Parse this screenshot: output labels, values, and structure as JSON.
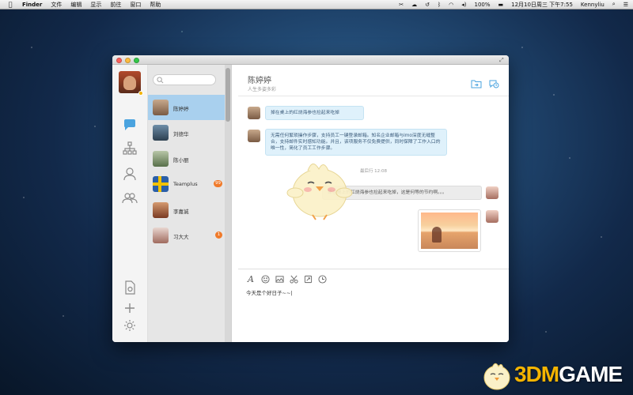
{
  "menubar": {
    "app": "Finder",
    "items": [
      "文件",
      "编辑",
      "显示",
      "前往",
      "窗口",
      "帮助"
    ],
    "battery": "100%",
    "datetime": "12月10日周三 下午7:55",
    "user": "Kennyliu"
  },
  "search": {
    "placeholder": ""
  },
  "contacts": [
    {
      "name": "陈婷婷",
      "badge": "",
      "active": true
    },
    {
      "name": "刘德华",
      "badge": ""
    },
    {
      "name": "陈小丽",
      "badge": ""
    },
    {
      "name": "Teamplus",
      "badge": "99"
    },
    {
      "name": "李嘉诚",
      "badge": ""
    },
    {
      "name": "习大大",
      "badge": "1"
    }
  ],
  "chat": {
    "title": "陈婷婷",
    "subtitle": "人生多姿多彩",
    "messages": [
      {
        "text": "掉在桌上的红烧海参也捡起来吃掉"
      },
      {
        "text": "无需任何繁琐操作步骤，支持员工一键登录邮箱。知名企业邮箱与imo深度无缝整合，支持邮件实时感知功能。并且，该项服务不仅免费提供，同时保障了工作入口的唯一性，简化了员工工作步骤。"
      },
      {
        "text": "掉在桌上的红烧海参也捡起来吃掉，这是何等的节约啊。。。"
      }
    ],
    "timestamp": "最后行 12:08",
    "composer_text": "今天是个好日子~~|"
  },
  "watermark": {
    "brand_prefix": "3DM",
    "brand_suffix": "GAME"
  },
  "colors": {
    "accent_blue": "#4aa3df",
    "badge_orange": "#f07a2a",
    "active_row": "#a9d0ee"
  }
}
